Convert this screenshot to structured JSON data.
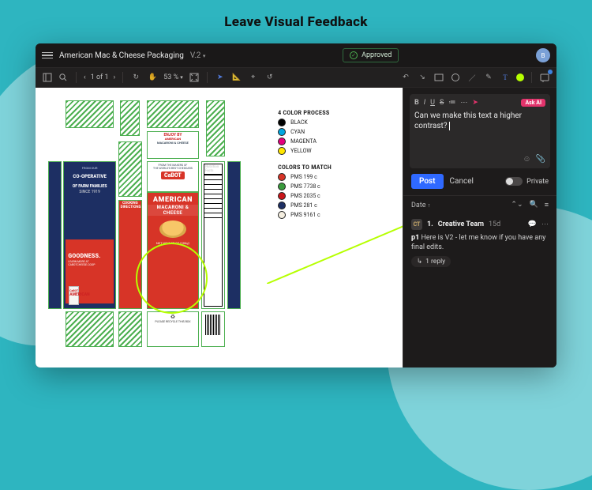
{
  "page_title": "Leave Visual Feedback",
  "titlebar": {
    "doc_title": "American Mac & Cheese Packaging",
    "version": "V.2",
    "approved_label": "Approved",
    "avatar_initials": "B"
  },
  "toolbar": {
    "page_of": "1 of 1",
    "zoom": "53 %"
  },
  "package": {
    "enjoy_by": "ENJOY BY",
    "top_american": "AMERICAN",
    "top_mac": "MACARONI & CHEESE",
    "coop_from": "FROM OUR",
    "coop_main": "CO-OPERATIVE",
    "coop_of": "OF FARM FAMILIES",
    "coop_since": "SINCE 1919",
    "goodness": "GOODNESS.",
    "learn": "LEARN MORE AT CABOTCHEESE.COOP",
    "cooking": "COOKING",
    "directions": "DIRECTIONS",
    "makers": "FROM THE MAKERS OF\nTHE WORLD'S BEST CHEDDARS",
    "cabot": "CaBOT",
    "front_american": "AMERICAN",
    "front_mac": "MACARONI & CHEESE",
    "net_wt": "NET WT 7.25 OZ (206g)",
    "nutrition_title": "Nutrition Facts",
    "bottom_american": "AMERICAN",
    "recycle": "PLEASE RECYCLE THIS BOX"
  },
  "legend": {
    "process_title": "4 COLOR PROCESS",
    "process": [
      {
        "name": "BLACK",
        "hex": "#000000"
      },
      {
        "name": "CYAN",
        "hex": "#00a7e1"
      },
      {
        "name": "MAGENTA",
        "hex": "#e5007e"
      },
      {
        "name": "YELLOW",
        "hex": "#ffe600"
      }
    ],
    "match_title": "COLORS TO MATCH",
    "match": [
      {
        "name": "PMS 199 c",
        "hex": "#d73427"
      },
      {
        "name": "PMS 7738 c",
        "hex": "#3a9b3d"
      },
      {
        "name": "PMS 2035 c",
        "hex": "#c9151a"
      },
      {
        "name": "PMS 281 c",
        "hex": "#1d2f63"
      },
      {
        "name": "PMS 9161 c",
        "hex": "#f4eee0"
      }
    ]
  },
  "composer": {
    "text": "Can we make this text a higher contrast?",
    "ask_ai": "Ask AI",
    "post": "Post",
    "cancel": "Cancel",
    "private": "Private"
  },
  "comments": {
    "sort_label": "Date",
    "items": [
      {
        "num": "1.",
        "author": "Creative Team",
        "avatar": "CT",
        "time": "15d",
        "body_prefix": "p1",
        "body": "Here is V2 - let me know if you have any final edits.",
        "reply_count": "1 reply"
      }
    ]
  }
}
